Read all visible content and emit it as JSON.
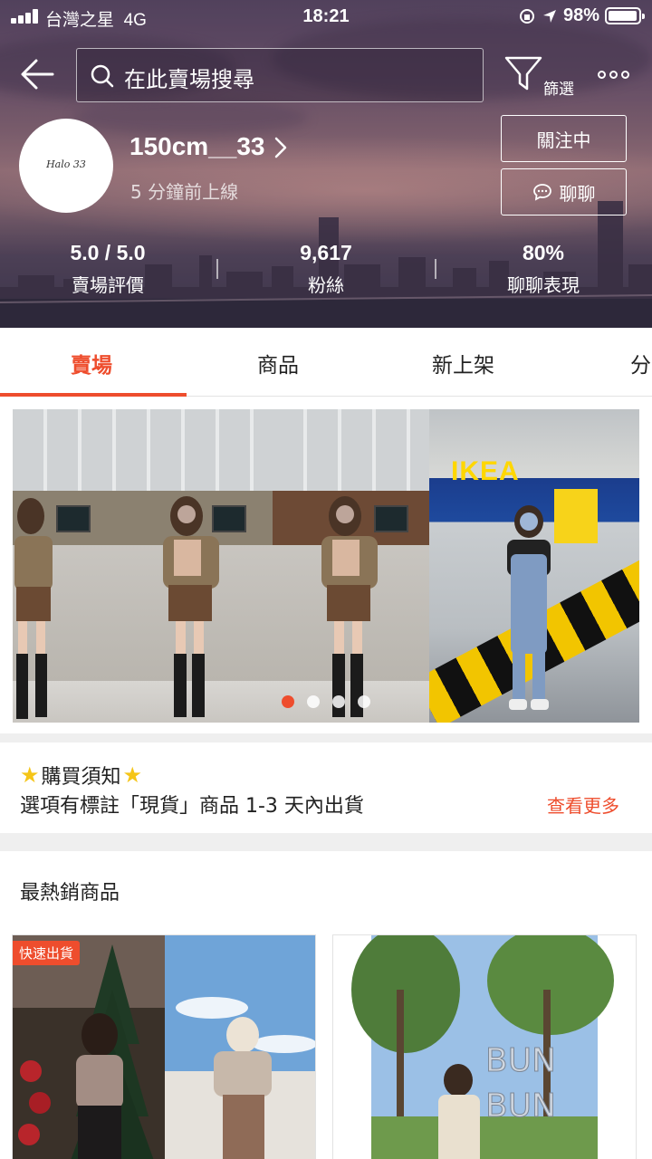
{
  "status_bar": {
    "carrier": "台灣之星",
    "network": "4G",
    "time": "18:21",
    "battery": "98%"
  },
  "header": {
    "search_placeholder": "在此賣場搜尋",
    "filter_label": "篩選"
  },
  "shop": {
    "logo_text": "Halo 33",
    "name": "150cm__33",
    "last_online": "5 分鐘前上線",
    "follow_label": "關注中",
    "chat_label": "聊聊",
    "stats": [
      {
        "value": "5.0 / 5.0",
        "label": "賣場評價"
      },
      {
        "value": "9,617",
        "label": "粉絲"
      },
      {
        "value": "80%",
        "label": "聊聊表現"
      }
    ]
  },
  "tabs": [
    "賣場",
    "商品",
    "新上架",
    "分"
  ],
  "banner": {
    "store_sign": "IKEA",
    "slide_count": 4,
    "active_slide": 1
  },
  "notice": {
    "title": "購買須知",
    "text": "選項有標註「現貨」商品 1-3 天內出貨",
    "more_label": "查看更多"
  },
  "best_sellers": {
    "title": "最熱銷商品",
    "badge": "快速出貨",
    "sign_text": "BUN BUN"
  },
  "colors": {
    "accent": "#ee4d2d",
    "star": "#f5c518"
  }
}
